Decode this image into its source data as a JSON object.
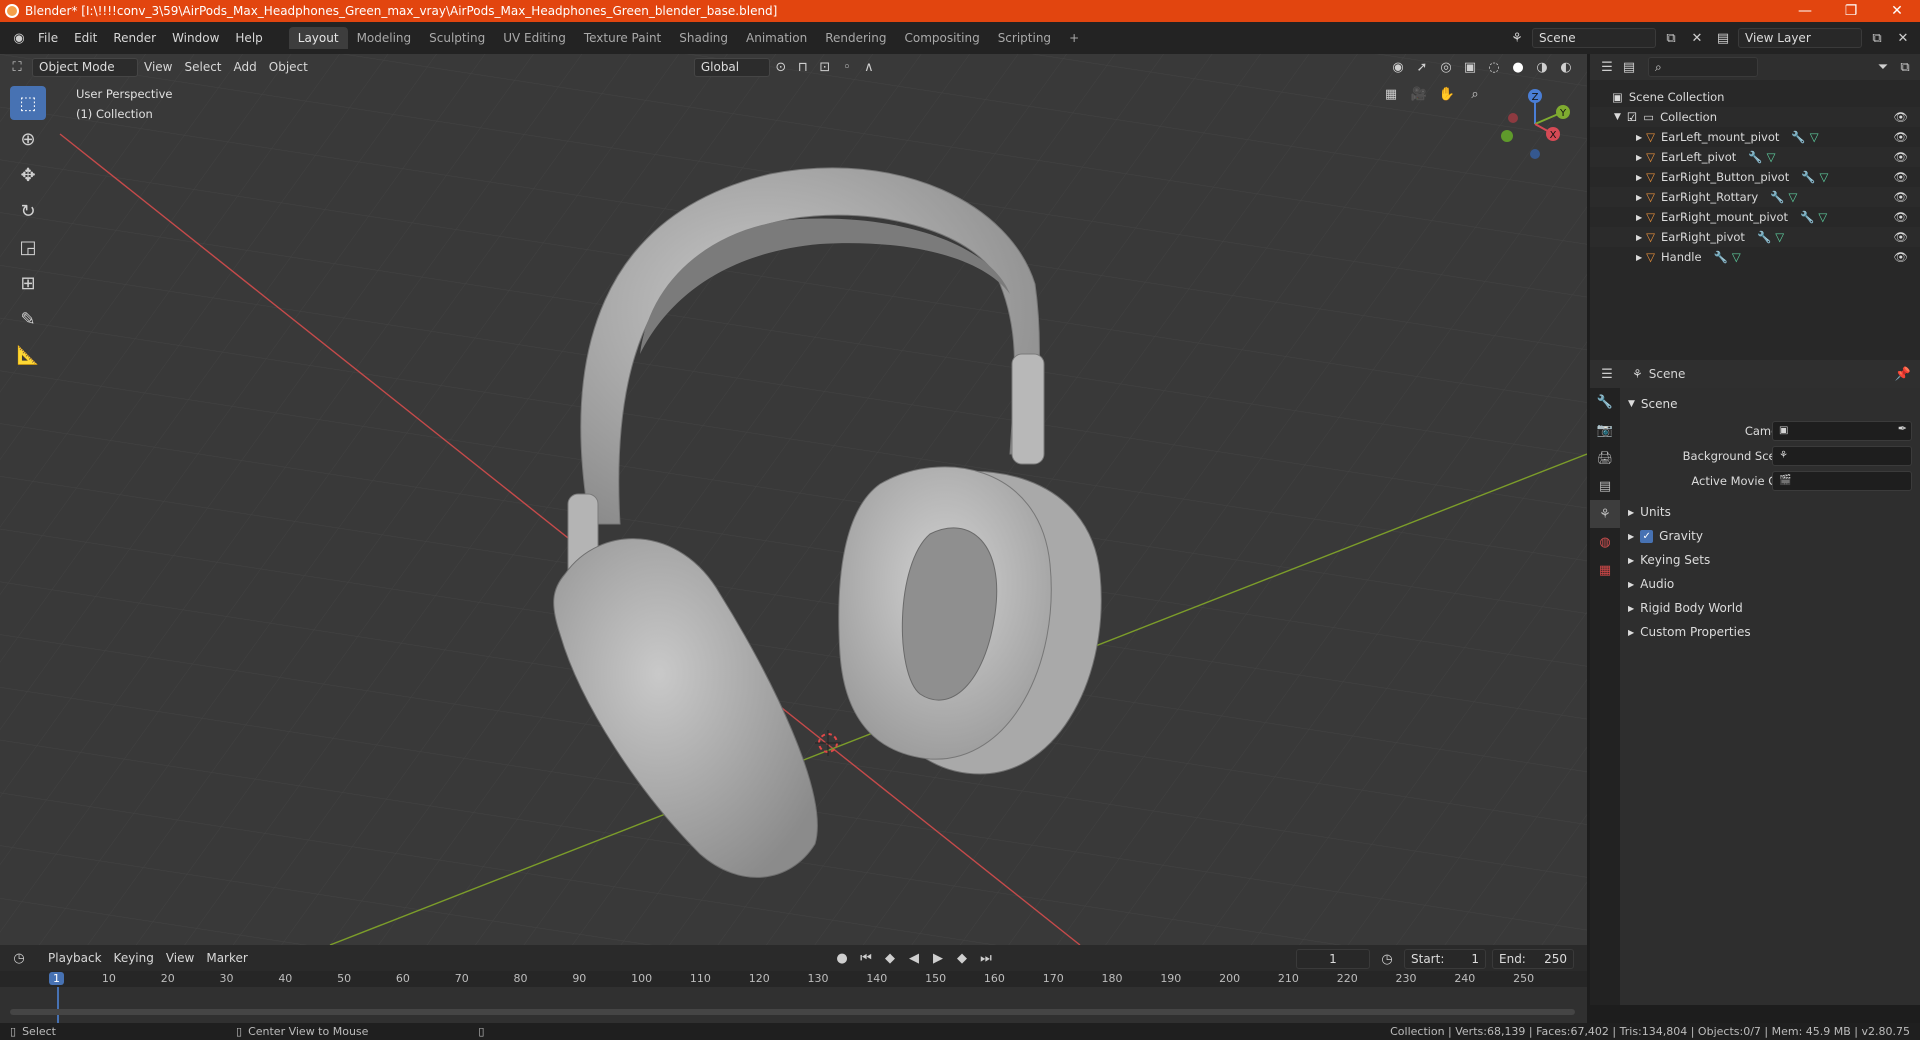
{
  "window": {
    "title": "Blender* [I:\\!!!!conv_3\\59\\AirPods_Max_Headphones_Green_max_vray\\AirPods_Max_Headphones_Green_blender_base.blend]",
    "controls": [
      "—",
      "❐",
      "✕"
    ]
  },
  "menu": [
    "File",
    "Edit",
    "Render",
    "Window",
    "Help"
  ],
  "workspaces": [
    "Layout",
    "Modeling",
    "Sculpting",
    "UV Editing",
    "Texture Paint",
    "Shading",
    "Animation",
    "Rendering",
    "Compositing",
    "Scripting"
  ],
  "active_workspace": "Layout",
  "add_workspace": "+",
  "scene_field": "Scene",
  "view_layer_field": "View Layer",
  "viewport": {
    "mode": "Object Mode",
    "menu": [
      "View",
      "Select",
      "Add",
      "Object"
    ],
    "orientation": "Global",
    "overlay_text": [
      "User Perspective",
      "(1) Collection"
    ],
    "gizmo_axes": [
      "Z",
      "Y",
      "X"
    ]
  },
  "outliner": {
    "root": "Scene Collection",
    "collection": "Collection",
    "items": [
      "EarLeft_mount_pivot",
      "EarLeft_pivot",
      "EarRight_Button_pivot",
      "EarRight_Rottary",
      "EarRight_mount_pivot",
      "EarRight_pivot",
      "Handle"
    ]
  },
  "properties": {
    "context": "Scene",
    "section": "Scene",
    "fields": [
      "Camera",
      "Background Scene",
      "Active Movie Clip"
    ],
    "panels": [
      "Units",
      "Gravity",
      "Keying Sets",
      "Audio",
      "Rigid Body World",
      "Custom Properties"
    ],
    "gravity_checked": true
  },
  "timeline": {
    "menu": [
      "Playback",
      "Keying",
      "View",
      "Marker"
    ],
    "current_frame": "1",
    "start_label": "Start:",
    "start": "1",
    "end_label": "End:",
    "end": "250",
    "ruler": [
      "1",
      "10",
      "20",
      "30",
      "40",
      "50",
      "60",
      "70",
      "80",
      "90",
      "100",
      "110",
      "120",
      "130",
      "140",
      "150",
      "160",
      "170",
      "180",
      "190",
      "200",
      "210",
      "220",
      "230",
      "240",
      "250"
    ]
  },
  "status": {
    "left": "Select",
    "middle": "Center View to Mouse",
    "right": "Collection | Verts:68,139 | Faces:67,402 | Tris:134,804 | Objects:0/7 | Mem: 45.9 MB | v2.80.75"
  },
  "colors": {
    "title_bar": "#e2450f",
    "accent": "#4772b3",
    "viewport_bg": "#393939",
    "x_axis": "#c54a4a",
    "y_axis": "#7c9d2a"
  }
}
